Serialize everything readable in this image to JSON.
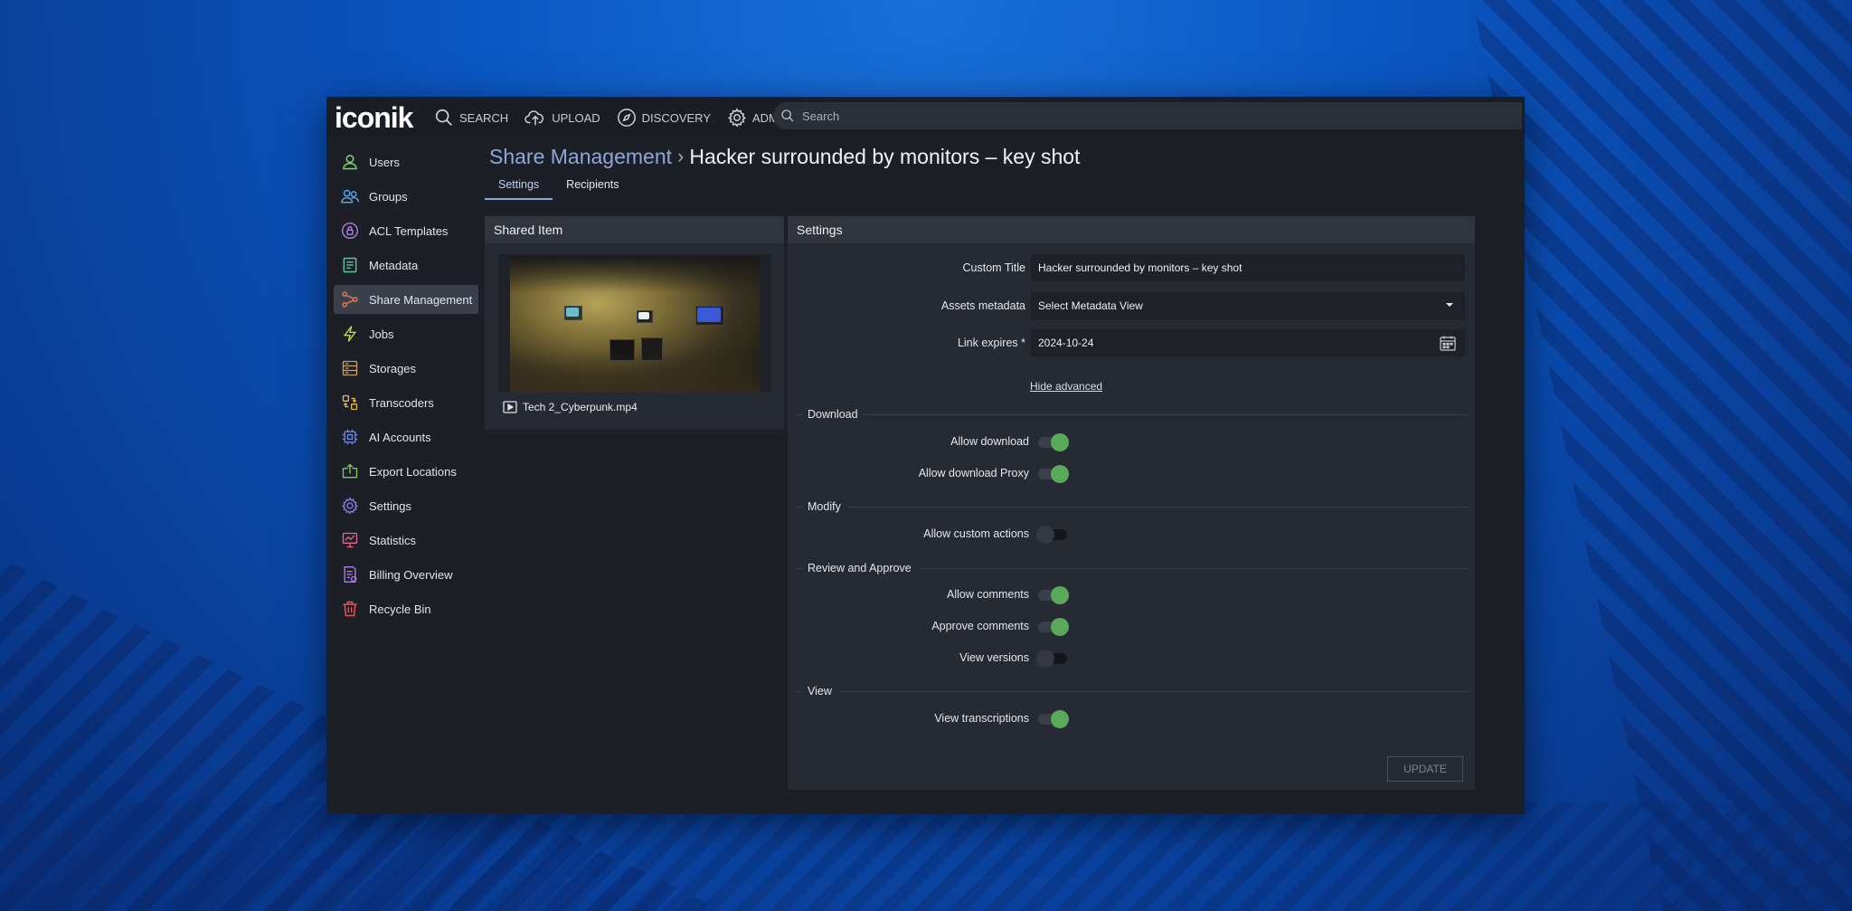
{
  "app": {
    "logo": "iconik"
  },
  "topnav": {
    "items": [
      {
        "label": "SEARCH",
        "icon": "search-icon"
      },
      {
        "label": "UPLOAD",
        "icon": "cloud-upload-icon"
      },
      {
        "label": "DISCOVERY",
        "icon": "compass-icon"
      },
      {
        "label": "ADMIN",
        "icon": "gear-icon"
      }
    ],
    "search_placeholder": "Search"
  },
  "sidebar": {
    "items": [
      {
        "label": "Users",
        "icon": "user-icon",
        "color": "#7fd07a"
      },
      {
        "label": "Groups",
        "icon": "users-icon",
        "color": "#5aa8e8"
      },
      {
        "label": "ACL Templates",
        "icon": "lock-icon",
        "color": "#b07ce8"
      },
      {
        "label": "Metadata",
        "icon": "document-icon",
        "color": "#5cc8a0"
      },
      {
        "label": "Share Management",
        "icon": "share-icon",
        "color": "#e8804a",
        "active": true
      },
      {
        "label": "Jobs",
        "icon": "lightning-icon",
        "color": "#b8d64a"
      },
      {
        "label": "Storages",
        "icon": "storage-icon",
        "color": "#c89a6a"
      },
      {
        "label": "Transcoders",
        "icon": "transcoder-icon",
        "color": "#e8b84a"
      },
      {
        "label": "AI Accounts",
        "icon": "chip-icon",
        "color": "#6a8ae8"
      },
      {
        "label": "Export Locations",
        "icon": "export-icon",
        "color": "#7ad05a"
      },
      {
        "label": "Settings",
        "icon": "gear-icon",
        "color": "#8a7ce8"
      },
      {
        "label": "Statistics",
        "icon": "chart-icon",
        "color": "#e86a8a"
      },
      {
        "label": "Billing Overview",
        "icon": "billing-icon",
        "color": "#b07ce8"
      },
      {
        "label": "Recycle Bin",
        "icon": "trash-icon",
        "color": "#e85a5a"
      }
    ]
  },
  "breadcrumb": {
    "parent": "Share Management",
    "current": "Hacker surrounded by monitors – key shot"
  },
  "tabs": [
    {
      "label": "Settings",
      "active": true
    },
    {
      "label": "Recipients",
      "active": false
    }
  ],
  "shared_item": {
    "header": "Shared Item",
    "filename": "Tech 2_Cyberpunk.mp4"
  },
  "settings": {
    "header": "Settings",
    "custom_title_label": "Custom Title",
    "custom_title_value": "Hacker surrounded by monitors – key shot",
    "assets_metadata_label": "Assets metadata",
    "assets_metadata_value": "Select Metadata View",
    "link_expires_label": "Link expires *",
    "link_expires_value": "2024-10-24",
    "hide_advanced": "Hide advanced",
    "sections": {
      "download": "Download",
      "modify": "Modify",
      "review": "Review and Approve",
      "view": "View"
    },
    "toggles": {
      "allow_download": {
        "label": "Allow download",
        "on": true
      },
      "allow_download_proxy": {
        "label": "Allow download Proxy",
        "on": true
      },
      "allow_custom_actions": {
        "label": "Allow custom actions",
        "on": false
      },
      "allow_comments": {
        "label": "Allow comments",
        "on": true
      },
      "approve_comments": {
        "label": "Approve comments",
        "on": true
      },
      "view_versions": {
        "label": "View versions",
        "on": false
      },
      "view_transcriptions": {
        "label": "View transcriptions",
        "on": true
      }
    },
    "update_label": "UPDATE"
  },
  "colors": {
    "accent": "#8fa6d9",
    "toggle_on": "#5aa85a"
  }
}
